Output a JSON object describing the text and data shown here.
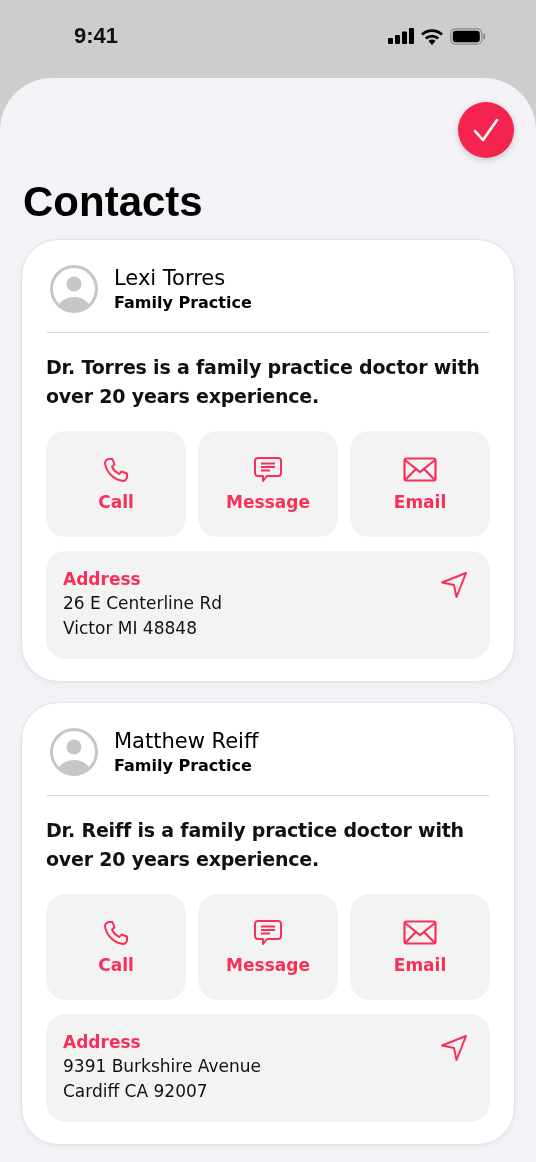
{
  "status_bar": {
    "time": "9:41"
  },
  "title": "Contacts",
  "contacts": [
    {
      "name": "Lexi Torres",
      "specialty": "Family Practice",
      "description": "Dr. Torres is a family practice doctor with over 20 years experience.",
      "actions": [
        {
          "kind": "call",
          "label": "Call"
        },
        {
          "kind": "message",
          "label": "Message"
        },
        {
          "kind": "email",
          "label": "Email"
        }
      ],
      "address": {
        "label": "Address",
        "lines": [
          "26 E Centerline Rd",
          "Victor MI 48848"
        ]
      }
    },
    {
      "name": "Matthew Reiff",
      "specialty": "Family Practice",
      "description": "Dr. Reiff is a family practice doctor with over 20 years experience.",
      "actions": [
        {
          "kind": "call",
          "label": "Call"
        },
        {
          "kind": "message",
          "label": "Message"
        },
        {
          "kind": "email",
          "label": "Email"
        }
      ],
      "address": {
        "label": "Address",
        "lines": [
          "9391 Burkshire Avenue",
          "Cardiff CA 92007"
        ]
      }
    }
  ]
}
